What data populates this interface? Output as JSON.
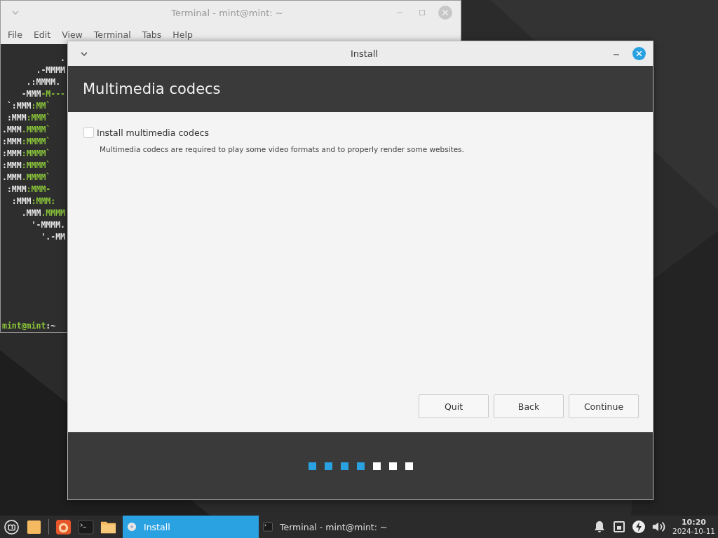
{
  "terminal_window": {
    "title": "Terminal - mint@mint: ~",
    "menu": [
      "File",
      "Edit",
      "View",
      "Terminal",
      "Tabs",
      "Help"
    ],
    "lines": [
      {
        "white": "            ."
      },
      {
        "white": "       .-MMMM"
      },
      {
        "white": "     .:MMMM."
      },
      {
        "white": "    -MMM",
        "green": "-M---"
      },
      {
        "white": " `:MMM",
        "green": ":MM`"
      },
      {
        "white": " :MMM",
        "green": ":MMM`"
      },
      {
        "white": ".MMM",
        "green": ".MMMM`"
      },
      {
        "white": ":MMM",
        "green": ":MMMM`"
      },
      {
        "white": ":MMM",
        "green": ":MMMM`"
      },
      {
        "white": ":MMM",
        "green": ":MMMM`"
      },
      {
        "white": ".MMM",
        "green": ".MMMM`"
      },
      {
        "white": " :MMM",
        "green": ":MMM-"
      },
      {
        "white": "  :MMM",
        "green": ":MMM:"
      },
      {
        "white": "    .MMM",
        "green": ".MMMM"
      },
      {
        "white": "      '-MMMM."
      },
      {
        "white": "        '.-MM"
      }
    ],
    "prompt": {
      "user": "mint@mint",
      "path": ":~"
    }
  },
  "install_window": {
    "title": "Install",
    "heading": "Multimedia codecs",
    "checkbox": {
      "label": "Install multimedia codecs",
      "checked": false
    },
    "description": "Multimedia codecs are required to play some video formats and to properly render some websites.",
    "buttons": [
      "Quit",
      "Back",
      "Continue"
    ],
    "steps": [
      {
        "done": true
      },
      {
        "done": true
      },
      {
        "done": true
      },
      {
        "done": true
      },
      {
        "done": false
      },
      {
        "done": false
      },
      {
        "done": false
      }
    ]
  },
  "taskbar": {
    "tasks": [
      {
        "label": "Install",
        "selected": true,
        "kind": "installer"
      },
      {
        "label": "Terminal - mint@mint: ~",
        "selected": false,
        "kind": "terminal"
      }
    ],
    "time": "10:20",
    "date": "2024-10-11"
  }
}
